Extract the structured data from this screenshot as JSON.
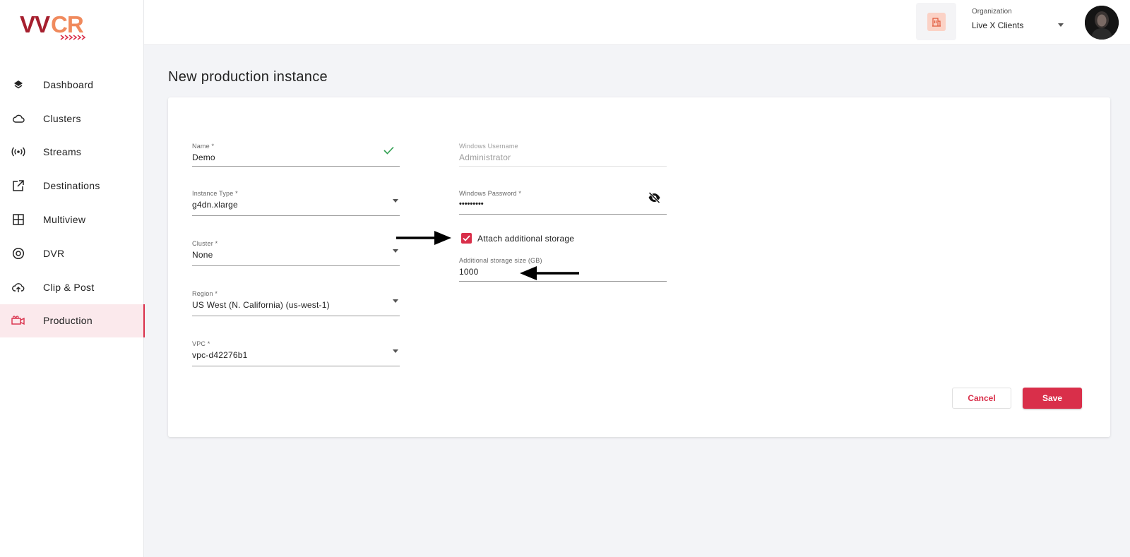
{
  "app": {
    "logo_text": "VVCR",
    "brand_color": "#d92f4a"
  },
  "sidebar": {
    "items": [
      {
        "label": "Dashboard",
        "icon": "layers-icon"
      },
      {
        "label": "Clusters",
        "icon": "cloud-icon"
      },
      {
        "label": "Streams",
        "icon": "broadcast-icon"
      },
      {
        "label": "Destinations",
        "icon": "external-link-icon"
      },
      {
        "label": "Multiview",
        "icon": "grid-icon"
      },
      {
        "label": "DVR",
        "icon": "record-icon"
      },
      {
        "label": "Clip & Post",
        "icon": "cloud-upload-icon"
      },
      {
        "label": "Production",
        "icon": "video-camera-icon",
        "active": true
      }
    ]
  },
  "header": {
    "org_label": "Organization",
    "org_value": "Live X Clients"
  },
  "page": {
    "title": "New production instance"
  },
  "form": {
    "name": {
      "label": "Name *",
      "value": "Demo",
      "valid": true
    },
    "instance_type": {
      "label": "Instance Type *",
      "value": "g4dn.xlarge"
    },
    "cluster": {
      "label": "Cluster *",
      "value": "None"
    },
    "region": {
      "label": "Region *",
      "value": "US West (N. California) (us-west-1)"
    },
    "vpc": {
      "label": "VPC *",
      "value": "vpc-d42276b1"
    },
    "windows_username": {
      "label": "Windows Username",
      "value": "Administrator",
      "disabled": true
    },
    "windows_password": {
      "label": "Windows Password *",
      "value": "•••••••••"
    },
    "attach_storage": {
      "label": "Attach additional storage",
      "checked": true
    },
    "storage_size": {
      "label": "Additional storage size (GB)",
      "value": "1000"
    }
  },
  "actions": {
    "cancel_label": "Cancel",
    "save_label": "Save"
  }
}
